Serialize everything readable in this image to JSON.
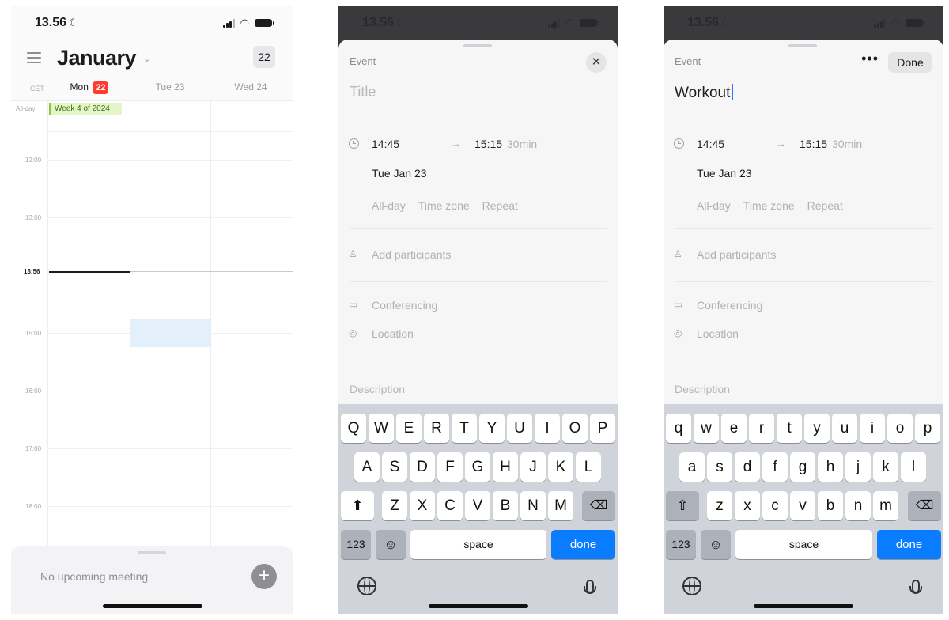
{
  "phone1": {
    "status": {
      "time": "13.56"
    },
    "header": {
      "month": "January",
      "today_button": "22"
    },
    "day_row": {
      "timezone": "CET",
      "days": [
        {
          "name": "Mon",
          "badge": "22"
        },
        {
          "name": "Tue 23"
        },
        {
          "name": "Wed 24"
        }
      ]
    },
    "grid": {
      "allday_label": "All-day",
      "week_chip": "Week 4 of 2024",
      "hours": [
        "12:00",
        "13:00",
        "15:00",
        "16:00",
        "17:00",
        "18:00"
      ],
      "now_label": "13:56"
    },
    "bottom": {
      "no_meeting": "No upcoming meeting",
      "add_icon": "plus-icon"
    }
  },
  "phone2": {
    "status": {
      "time": "13.56"
    },
    "event": {
      "label": "Event",
      "title_placeholder": "Title",
      "start": "14:45",
      "end": "15:15",
      "duration": "30min",
      "date": "Tue Jan 23",
      "options": [
        "All-day",
        "Time zone",
        "Repeat"
      ],
      "participants": "Add participants",
      "conferencing": "Conferencing",
      "location": "Location",
      "description": "Description"
    },
    "keyboard": {
      "row1": [
        "Q",
        "W",
        "E",
        "R",
        "T",
        "Y",
        "U",
        "I",
        "O",
        "P"
      ],
      "row2": [
        "A",
        "S",
        "D",
        "F",
        "G",
        "H",
        "J",
        "K",
        "L"
      ],
      "row3": [
        "Z",
        "X",
        "C",
        "V",
        "B",
        "N",
        "M"
      ],
      "numbers": "123",
      "space": "space",
      "done": "done"
    }
  },
  "phone3": {
    "status": {
      "time": "13.56"
    },
    "event": {
      "label": "Event",
      "more": "•••",
      "done": "Done",
      "title": "Workout",
      "start": "14:45",
      "end": "15:15",
      "duration": "30min",
      "date": "Tue Jan 23",
      "options": [
        "All-day",
        "Time zone",
        "Repeat"
      ],
      "participants": "Add participants",
      "conferencing": "Conferencing",
      "location": "Location",
      "description": "Description"
    },
    "keyboard": {
      "row1": [
        "q",
        "w",
        "e",
        "r",
        "t",
        "y",
        "u",
        "i",
        "o",
        "p"
      ],
      "row2": [
        "a",
        "s",
        "d",
        "f",
        "g",
        "h",
        "j",
        "k",
        "l"
      ],
      "row3": [
        "z",
        "x",
        "c",
        "v",
        "b",
        "n",
        "m"
      ],
      "numbers": "123",
      "space": "space",
      "done": "done"
    }
  }
}
